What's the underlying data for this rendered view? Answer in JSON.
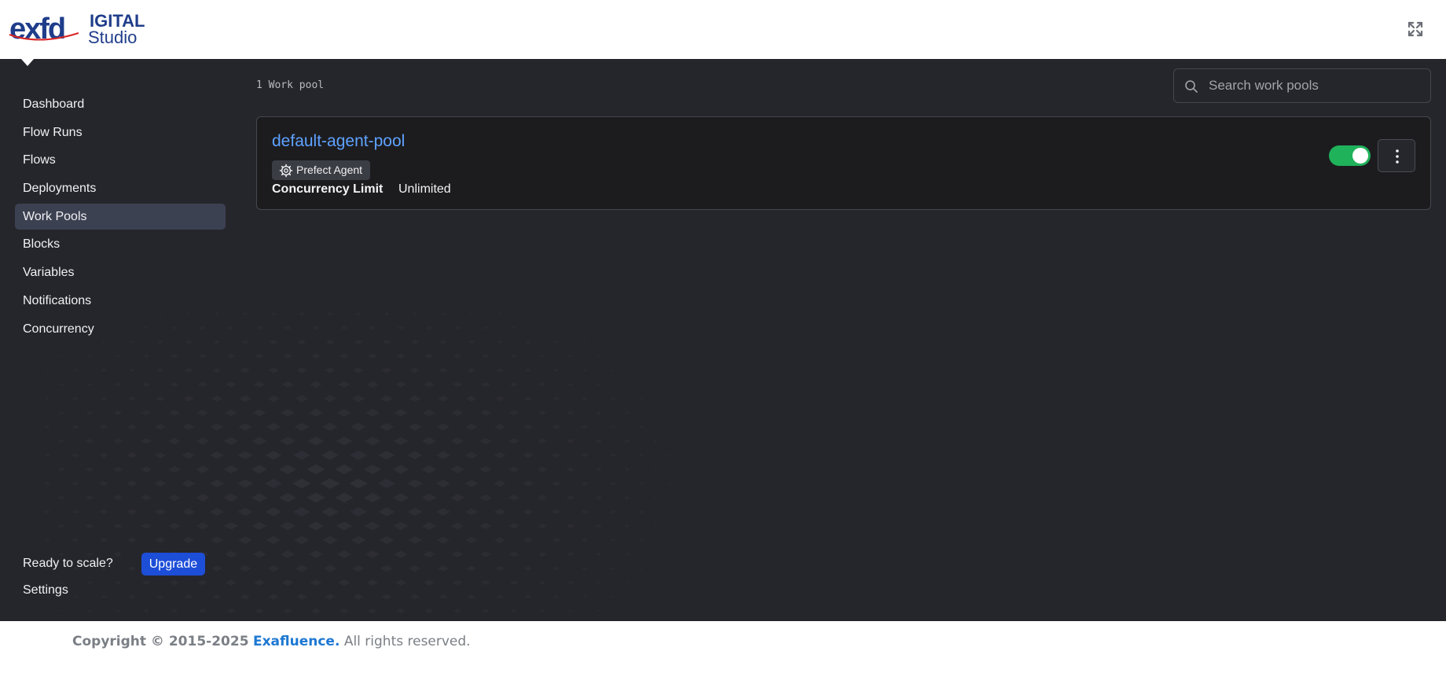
{
  "header": {
    "logo_ex": "exf",
    "logo_tail": "d",
    "logo_digital": "IGITAL",
    "logo_studio": "Studio",
    "expand_icon": "expand-arrows-icon"
  },
  "sidebar": {
    "items": [
      {
        "label": "Dashboard",
        "active": false
      },
      {
        "label": "Flow Runs",
        "active": false
      },
      {
        "label": "Flows",
        "active": false
      },
      {
        "label": "Deployments",
        "active": false
      },
      {
        "label": "Work Pools",
        "active": true
      },
      {
        "label": "Blocks",
        "active": false
      },
      {
        "label": "Variables",
        "active": false
      },
      {
        "label": "Notifications",
        "active": false
      },
      {
        "label": "Concurrency",
        "active": false
      }
    ],
    "scale_text": "Ready to scale?",
    "upgrade_label": "Upgrade",
    "settings_label": "Settings"
  },
  "main": {
    "count_label": "1 Work pool",
    "search": {
      "placeholder": "Search work pools",
      "value": ""
    },
    "pools": [
      {
        "name": "default-agent-pool",
        "type_label": "Prefect Agent",
        "concurrency_label": "Concurrency Limit",
        "concurrency_value": "Unlimited",
        "enabled": true
      }
    ]
  },
  "footer": {
    "copyright": "Copyright © 2015-2025",
    "brand": "Exafluence.",
    "rights": "All rights reserved."
  },
  "colors": {
    "app_bg": "#25262b",
    "card_bg": "#1c1c1f",
    "active_nav": "#3c4152",
    "link": "#5ea2ff",
    "toggle_on": "#1fb25a",
    "upgrade": "#1d4ed8",
    "footer_brand": "#1d78d3"
  }
}
